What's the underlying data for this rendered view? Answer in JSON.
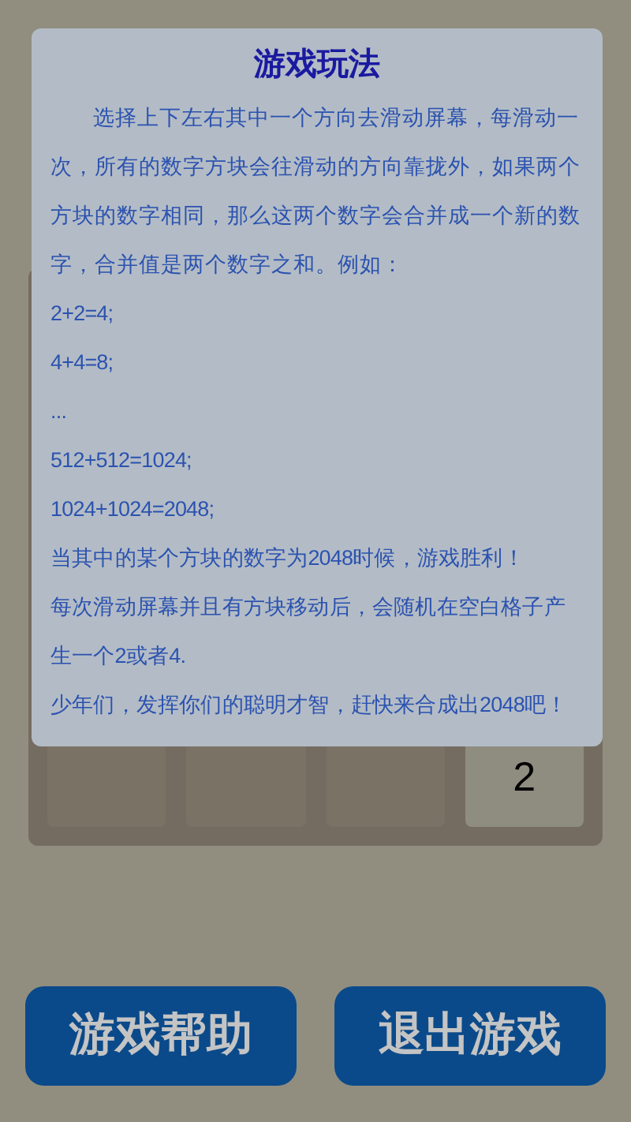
{
  "game": {
    "bottom_row": [
      {
        "kind": "empty"
      },
      {
        "kind": "empty"
      },
      {
        "kind": "empty"
      },
      {
        "kind": "tile",
        "value": "2"
      }
    ]
  },
  "dialog": {
    "title": "游戏玩法",
    "paragraphs": [
      {
        "text": "选择上下左右其中一个方向去滑动屏幕，每滑动一次，所有的数字方块会往滑动的方向靠拢外，如果两个方块的数字相同，那么这两个数字会合并成一个新的数字，合并值是两个数字之和。例如：",
        "indent": true
      },
      {
        "text": "2+2=4;",
        "indent": false
      },
      {
        "text": "4+4=8;",
        "indent": false
      },
      {
        "text": "...",
        "indent": false
      },
      {
        "text": "512+512=1024;",
        "indent": false
      },
      {
        "text": "1024+1024=2048;",
        "indent": false
      },
      {
        "text": "当其中的某个方块的数字为2048时候，游戏胜利！",
        "indent": false
      },
      {
        "text": "每次滑动屏幕并且有方块移动后，会随机在空白格子产生一个2或者4.",
        "indent": false
      },
      {
        "text": "少年们，发挥你们的聪明才智，赶快来合成出2048吧！",
        "indent": false
      }
    ]
  },
  "buttons": [
    "游戏帮助",
    "退出游戏"
  ]
}
